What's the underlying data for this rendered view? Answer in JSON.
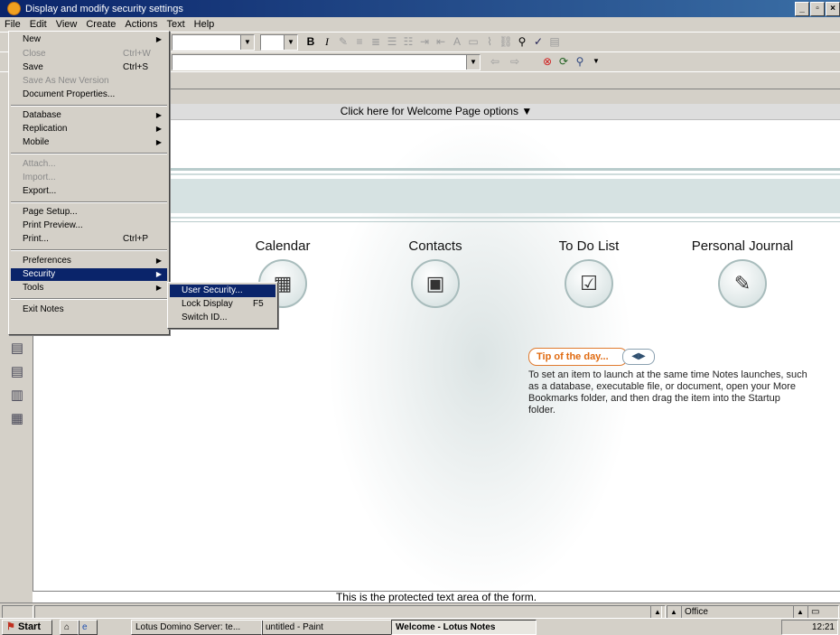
{
  "window": {
    "title": "Display and modify security settings"
  },
  "menubar": [
    "File",
    "Edit",
    "View",
    "Create",
    "Actions",
    "Text",
    "Help"
  ],
  "file_menu": [
    {
      "label": "New",
      "shortcut": "",
      "submenu": true,
      "disabled": false
    },
    {
      "label": "Close",
      "shortcut": "Ctrl+W",
      "submenu": false,
      "disabled": true
    },
    {
      "label": "Save",
      "shortcut": "Ctrl+S",
      "submenu": false,
      "disabled": false
    },
    {
      "label": "Save As New Version",
      "shortcut": "",
      "submenu": false,
      "disabled": true
    },
    {
      "label": "Document Properties...",
      "shortcut": "",
      "submenu": false,
      "disabled": false
    },
    {
      "label": "Database",
      "shortcut": "",
      "submenu": true,
      "disabled": false
    },
    {
      "label": "Replication",
      "shortcut": "",
      "submenu": true,
      "disabled": false
    },
    {
      "label": "Mobile",
      "shortcut": "",
      "submenu": true,
      "disabled": false
    },
    {
      "label": "Attach...",
      "shortcut": "",
      "submenu": false,
      "disabled": true
    },
    {
      "label": "Import...",
      "shortcut": "",
      "submenu": false,
      "disabled": true
    },
    {
      "label": "Export...",
      "shortcut": "",
      "submenu": false,
      "disabled": false
    },
    {
      "label": "Page Setup...",
      "shortcut": "",
      "submenu": false,
      "disabled": false
    },
    {
      "label": "Print Preview...",
      "shortcut": "",
      "submenu": false,
      "disabled": false
    },
    {
      "label": "Print...",
      "shortcut": "Ctrl+P",
      "submenu": false,
      "disabled": false
    },
    {
      "label": "Preferences",
      "shortcut": "",
      "submenu": true,
      "disabled": false
    },
    {
      "label": "Security",
      "shortcut": "",
      "submenu": true,
      "disabled": false,
      "highlighted": true
    },
    {
      "label": "Tools",
      "shortcut": "",
      "submenu": true,
      "disabled": false
    },
    {
      "label": "Exit Notes",
      "shortcut": "",
      "submenu": false,
      "disabled": false
    }
  ],
  "security_menu": [
    {
      "label": "User Security...",
      "shortcut": "",
      "highlighted": true
    },
    {
      "label": "Lock Display",
      "shortcut": "F5",
      "highlighted": false
    },
    {
      "label": "Switch ID...",
      "shortcut": "",
      "highlighted": false
    }
  ],
  "content": {
    "welcome_options": "Click here for Welcome Page options ▼",
    "launch_items": [
      {
        "label": "Calendar",
        "icon": "calendar-icon",
        "glyph": "▦"
      },
      {
        "label": "Contacts",
        "icon": "contacts-icon",
        "glyph": "▣"
      },
      {
        "label": "To Do List",
        "icon": "todo-icon",
        "glyph": "☑"
      },
      {
        "label": "Personal Journal",
        "icon": "journal-icon",
        "glyph": "✎"
      }
    ],
    "tip_title": "Tip of the day...",
    "tip_text": "To set an item to launch at the same time Notes launches, such as a database, executable file, or document, open your More Bookmarks folder, and then drag the item into the Startup folder.",
    "protected_text": "This is the protected text area of the form."
  },
  "statusbar": {
    "location": "Office"
  },
  "taskbar": {
    "start": "Start",
    "tasks": [
      {
        "label": "Lotus Domino Server: te...",
        "active": false
      },
      {
        "label": "untitled - Paint",
        "active": false
      },
      {
        "label": "Welcome - Lotus Notes",
        "active": true
      }
    ],
    "clock": "12:21"
  },
  "colors": {
    "titlebar": "#0a246a",
    "menu_highlight": "#0a246a",
    "tip_accent": "#e06a10"
  }
}
